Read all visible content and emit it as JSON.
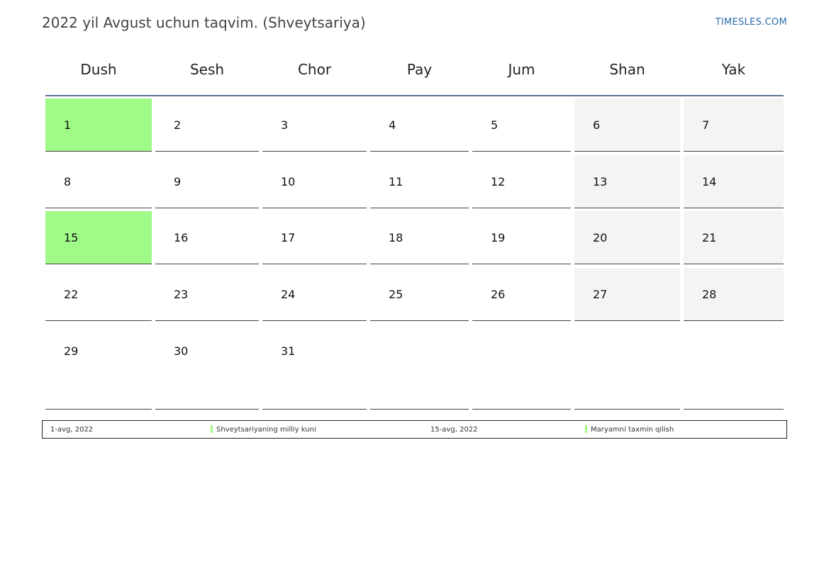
{
  "header": {
    "title": "2022 yil Avgust uchun taqvim. (Shveytsariya)",
    "brand": "TIMESLES.COM"
  },
  "weekdays": [
    "Dush",
    "Sesh",
    "Chor",
    "Pay",
    "Jum",
    "Shan",
    "Yak"
  ],
  "weeks": [
    [
      {
        "d": "1",
        "type": "holiday"
      },
      {
        "d": "2",
        "type": "normal"
      },
      {
        "d": "3",
        "type": "normal"
      },
      {
        "d": "4",
        "type": "normal"
      },
      {
        "d": "5",
        "type": "normal"
      },
      {
        "d": "6",
        "type": "weekend"
      },
      {
        "d": "7",
        "type": "weekend"
      }
    ],
    [
      {
        "d": "8",
        "type": "normal"
      },
      {
        "d": "9",
        "type": "normal"
      },
      {
        "d": "10",
        "type": "normal"
      },
      {
        "d": "11",
        "type": "normal"
      },
      {
        "d": "12",
        "type": "normal"
      },
      {
        "d": "13",
        "type": "weekend"
      },
      {
        "d": "14",
        "type": "weekend"
      }
    ],
    [
      {
        "d": "15",
        "type": "holiday"
      },
      {
        "d": "16",
        "type": "normal"
      },
      {
        "d": "17",
        "type": "normal"
      },
      {
        "d": "18",
        "type": "normal"
      },
      {
        "d": "19",
        "type": "normal"
      },
      {
        "d": "20",
        "type": "weekend"
      },
      {
        "d": "21",
        "type": "weekend"
      }
    ],
    [
      {
        "d": "22",
        "type": "normal"
      },
      {
        "d": "23",
        "type": "normal"
      },
      {
        "d": "24",
        "type": "normal"
      },
      {
        "d": "25",
        "type": "normal"
      },
      {
        "d": "26",
        "type": "normal"
      },
      {
        "d": "27",
        "type": "weekend"
      },
      {
        "d": "28",
        "type": "weekend"
      }
    ],
    [
      {
        "d": "29",
        "type": "normal"
      },
      {
        "d": "30",
        "type": "normal"
      },
      {
        "d": "31",
        "type": "normal"
      },
      {
        "d": "",
        "type": "empty"
      },
      {
        "d": "",
        "type": "empty"
      },
      {
        "d": "",
        "type": "empty"
      },
      {
        "d": "",
        "type": "empty"
      }
    ]
  ],
  "legend": {
    "holiday1_date": "1-avg, 2022",
    "holiday1_name": "Shveytsariyaning milliy kuni",
    "holiday2_date": "15-avg, 2022",
    "holiday2_name": "Maryamni taxmin qilish"
  },
  "colors": {
    "holiday": "#a0fa87",
    "weekend": "#f4f4f4",
    "header_rule": "#5b7396",
    "brand": "#2a6ead"
  }
}
